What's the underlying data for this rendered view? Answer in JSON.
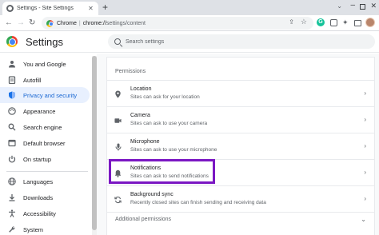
{
  "tab": {
    "title": "Settings - Site Settings",
    "close": "✕",
    "new_tab": "+"
  },
  "window": {
    "tab_menu": "⌄",
    "minimize": "–",
    "close": "✕"
  },
  "toolbar": {
    "back": "←",
    "forward": "→",
    "reload": "↻",
    "origin": "Chrome",
    "separator": "|",
    "url_host": "chrome://",
    "url_path": "settings/content",
    "share": "⇪",
    "star": "☆"
  },
  "extensions": {
    "grammarly": "G",
    "puzzle": "✦"
  },
  "header": {
    "title": "Settings",
    "search_placeholder": "Search settings"
  },
  "sidebar": {
    "items": [
      {
        "label": "You and Google",
        "icon": "person-icon"
      },
      {
        "label": "Autofill",
        "icon": "clipboard-icon"
      },
      {
        "label": "Privacy and security",
        "icon": "shield-icon",
        "active": true
      },
      {
        "label": "Appearance",
        "icon": "palette-icon"
      },
      {
        "label": "Search engine",
        "icon": "search-icon"
      },
      {
        "label": "Default browser",
        "icon": "browser-icon"
      },
      {
        "label": "On startup",
        "icon": "power-icon"
      },
      {
        "label": "Languages",
        "icon": "globe-icon"
      },
      {
        "label": "Downloads",
        "icon": "download-icon"
      },
      {
        "label": "Accessibility",
        "icon": "accessibility-icon"
      },
      {
        "label": "System",
        "icon": "wrench-icon"
      }
    ]
  },
  "main": {
    "section_title": "Permissions",
    "permissions": [
      {
        "title": "Location",
        "desc": "Sites can ask for your location",
        "icon": "location-pin-icon"
      },
      {
        "title": "Camera",
        "desc": "Sites can ask to use your camera",
        "icon": "camera-icon"
      },
      {
        "title": "Microphone",
        "desc": "Sites can ask to use your microphone",
        "icon": "microphone-icon"
      },
      {
        "title": "Notifications",
        "desc": "Sites can ask to send notifications",
        "icon": "bell-icon"
      },
      {
        "title": "Background sync",
        "desc": "Recently closed sites can finish sending and receiving data",
        "icon": "sync-icon"
      }
    ],
    "chevron": "›",
    "additional_permissions": "Additional permissions",
    "additional_chevron": "⌄"
  },
  "colors": {
    "accent": "#1a73e8",
    "active_bg": "#e8f0fe",
    "highlight": "#7b17c3"
  }
}
